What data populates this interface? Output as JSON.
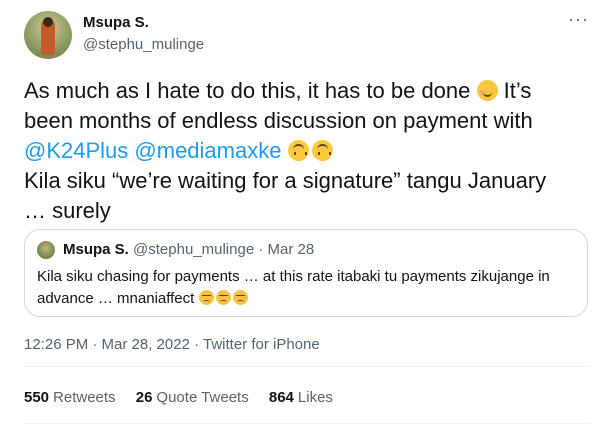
{
  "author": {
    "name": "Msupa S.",
    "handle": "@stephu_mulinge"
  },
  "more_menu": "···",
  "tweet": {
    "line1": "As much as I hate to do this, it has to be done",
    "line1_tail": "It’s",
    "line2": "been months of endless discussion on payment with",
    "mention1": "@K24Plus",
    "mention2": "@mediamaxke",
    "line4": "Kila siku “we’re waiting for a signature” tangu January",
    "line5": "… surely"
  },
  "quoted": {
    "name": "Msupa S.",
    "meta": "@stephu_mulinge · Mar 28",
    "line1": "Kila siku chasing for payments … at this rate itabaki tu payments zikujange in",
    "line2": "advance … mnaniaffect"
  },
  "timestamp": "12:26 PM · Mar 28, 2022 · Twitter for iPhone",
  "stats": {
    "retweets_count": "550",
    "retweets_label": "Retweets",
    "quotes_count": "26",
    "quotes_label": "Quote Tweets",
    "likes_count": "864",
    "likes_label": "Likes"
  },
  "icons": {
    "smile": "smiling-face-with-smiling-eyes-icon",
    "upside": "upside-down-face-icon",
    "unamused": "unamused-face-icon"
  },
  "colors": {
    "text": "#0f1419",
    "secondary": "#536471",
    "link": "#1d9bf0",
    "border": "#cfd9de"
  }
}
